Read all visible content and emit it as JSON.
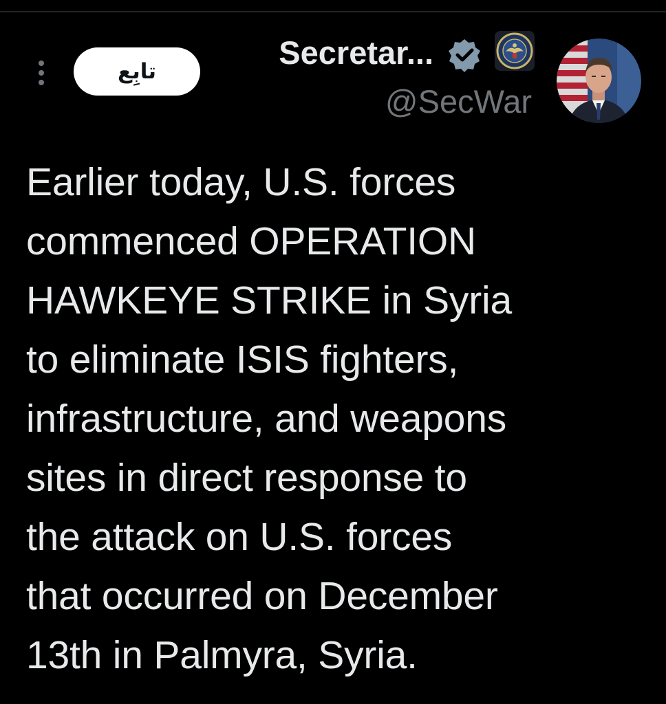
{
  "header": {
    "follow_label": "تابِع",
    "display_name": "Secretar...",
    "handle": "@SecWar"
  },
  "icons": {
    "more": "more-vertical-icon",
    "verified": "verified-badge-icon",
    "affiliate": "department-seal-icon",
    "avatar": "profile-photo"
  },
  "colors": {
    "background": "#000000",
    "text_primary": "#e7e9ea",
    "text_secondary": "#71767b",
    "follow_button_bg": "#ffffff",
    "follow_button_text": "#0f1419",
    "verified_badge": "#829aab"
  },
  "tweet": {
    "text": "Earlier today, U.S. forces\ncommenced OPERATION\nHAWKEYE STRIKE in Syria\nto eliminate ISIS fighters,\ninfrastructure, and weapons\nsites in direct response to\nthe attack on U.S. forces\nthat occurred on December\n13th in Palmyra, Syria."
  }
}
